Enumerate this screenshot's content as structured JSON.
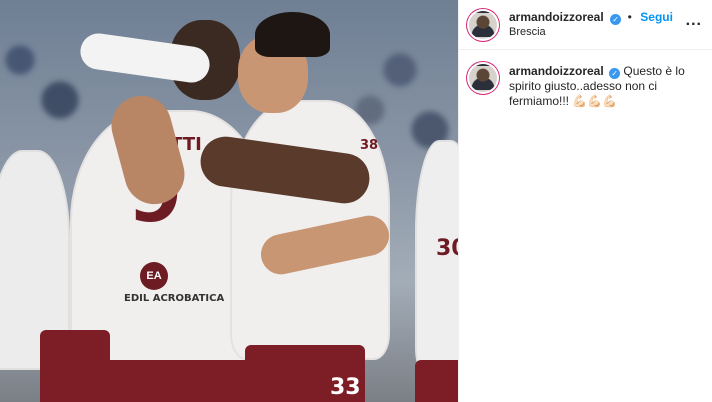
{
  "post": {
    "username": "armandoizzoreal",
    "location": "Brescia",
    "follow_label": "Segui",
    "separator": "•",
    "more_label": "...",
    "caption_text": "Questo è lo spirito giusto..adesso non ci fermiamo!!!",
    "caption_emojis": "💪🏻💪🏻💪🏻"
  },
  "media": {
    "jersey_name": "BELOTTI",
    "jersey_number": "9",
    "sponsor_logo": "EA",
    "sponsor_text": "EDIL ACROBATICA",
    "other_number_1": "38",
    "other_number_2": "33",
    "side_number": "30"
  },
  "colors": {
    "accent": "#0095f6",
    "verified": "#3897f0",
    "kit_primary": "#7d1e26",
    "kit_secondary": "#f1eeee"
  }
}
